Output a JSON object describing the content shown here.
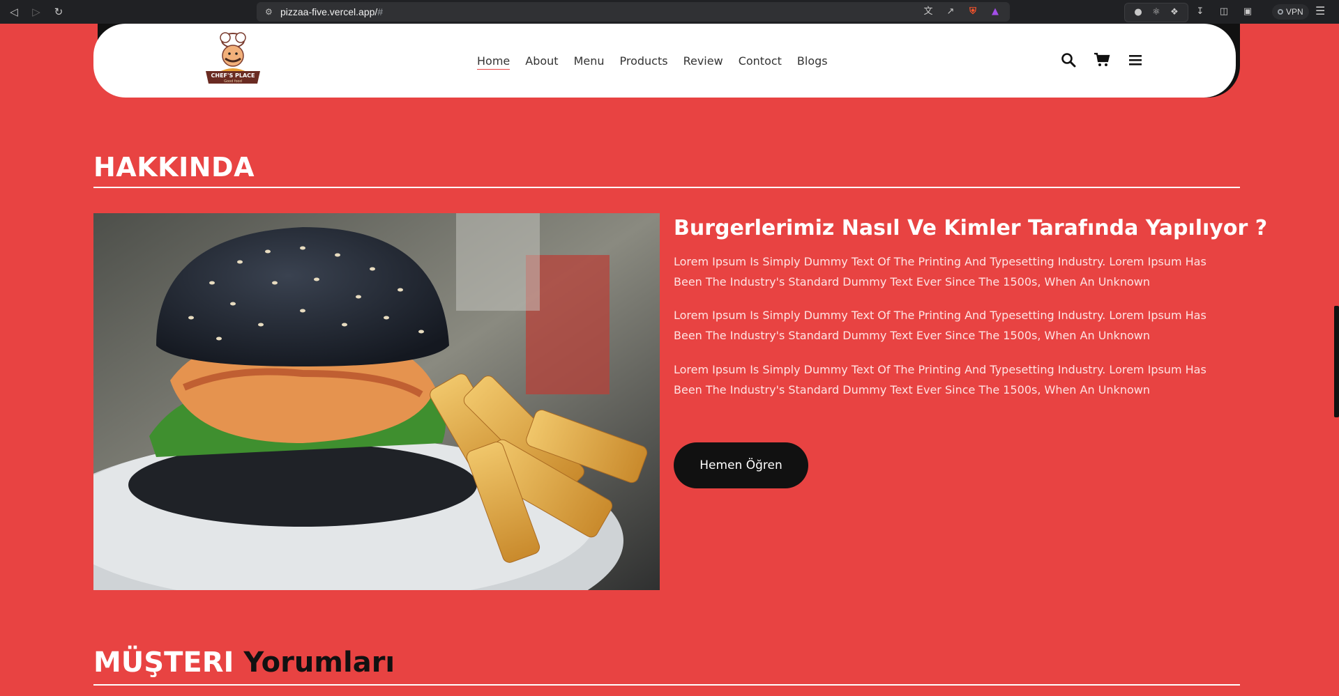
{
  "browser": {
    "url_main": "pizzaa-five.vercel.app/",
    "url_hash": "#",
    "vpn_label": "VPN"
  },
  "header": {
    "logo_text": "CHEF'S PLACE",
    "logo_subtext": "Good food",
    "nav": [
      {
        "label": "Home",
        "active": true
      },
      {
        "label": "About",
        "active": false
      },
      {
        "label": "Menu",
        "active": false
      },
      {
        "label": "Products",
        "active": false
      },
      {
        "label": "Review",
        "active": false
      },
      {
        "label": "Contoct",
        "active": false
      },
      {
        "label": "Blogs",
        "active": false
      }
    ],
    "icons": [
      "search-icon",
      "cart-icon",
      "hamburger-menu-icon"
    ]
  },
  "about": {
    "title": "HAKKINDA",
    "heading": "Burgerlerimiz Nasıl Ve Kimler Tarafında Yapılıyor ?",
    "paragraphs": [
      "Lorem Ipsum Is Simply Dummy Text Of The Printing And Typesetting Industry. Lorem Ipsum Has Been The Industry's Standard Dummy Text Ever Since The 1500s, When An Unknown",
      "Lorem Ipsum Is Simply Dummy Text Of The Printing And Typesetting Industry. Lorem Ipsum Has Been The Industry's Standard Dummy Text Ever Since The 1500s, When An Unknown",
      "Lorem Ipsum Is Simply Dummy Text Of The Printing And Typesetting Industry. Lorem Ipsum Has Been The Industry's Standard Dummy Text Ever Since The 1500s, When An Unknown"
    ],
    "button_label": "Hemen Öğren"
  },
  "reviews": {
    "title_white": "MÜŞTERI",
    "title_dark": "Yorumları"
  },
  "colors": {
    "page_background": "#e84342",
    "header_background": "#ffffff",
    "button_background": "#111111",
    "accent": "#e84342"
  }
}
